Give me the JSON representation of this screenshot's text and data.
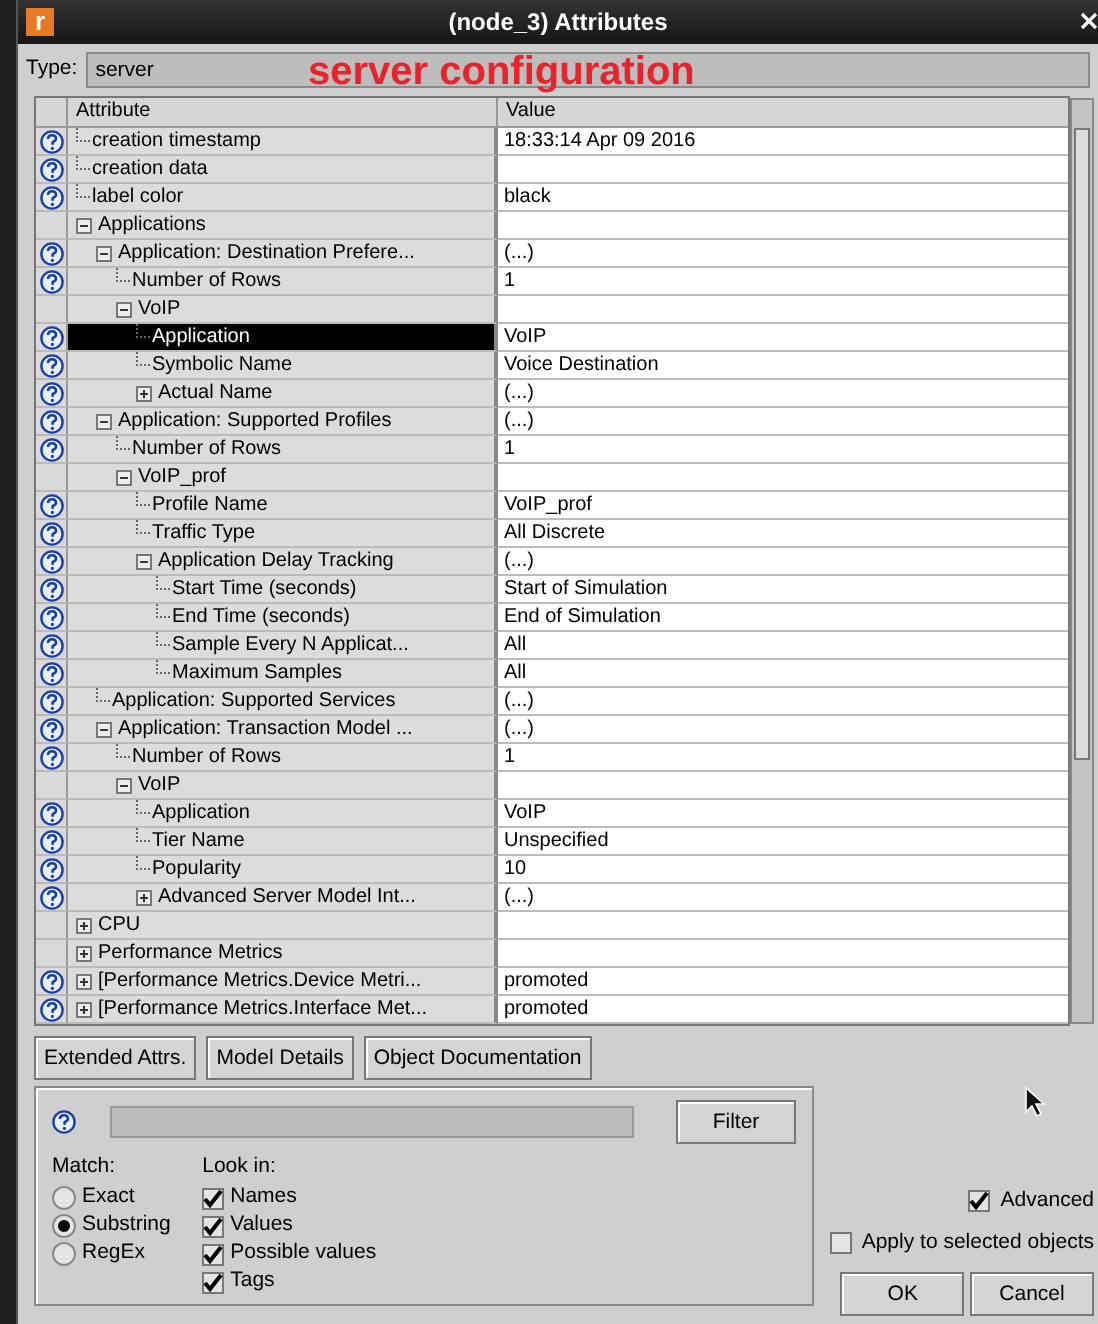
{
  "window": {
    "logo": "r",
    "title": "(node_3) Attributes"
  },
  "type": {
    "label": "Type:",
    "value": "server"
  },
  "annotation": "server configuration",
  "table": {
    "columns": [
      "Attribute",
      "Value"
    ],
    "rows": [
      {
        "name": "creation timestamp",
        "value": "18:33:14 Apr 09 2016",
        "help": true,
        "selected": false
      },
      {
        "name": "creation data",
        "help": true,
        "selected": false
      },
      {
        "name": "label color",
        "value": "black",
        "help": true,
        "selected": false
      },
      {
        "name": "Applications",
        "help": false,
        "expanded": true,
        "selected": false,
        "children": [
          {
            "name": "Application: Destination Prefere...",
            "value": "(...)",
            "help": true,
            "expanded": true,
            "selected": false,
            "children": [
              {
                "name": "Number of Rows",
                "value": "1",
                "help": true,
                "selected": false
              },
              {
                "name": "VoIP",
                "help": false,
                "expanded": true,
                "selected": false,
                "children": [
                  {
                    "name": "Application",
                    "value": "VoIP",
                    "help": true,
                    "selected": true
                  },
                  {
                    "name": "Symbolic Name",
                    "value": "Voice Destination",
                    "help": true,
                    "selected": false
                  },
                  {
                    "name": "Actual Name",
                    "value": "(...)",
                    "help": true,
                    "expanded": false,
                    "selected": false
                  }
                ]
              }
            ]
          },
          {
            "name": "Application: Supported Profiles",
            "value": "(...)",
            "help": true,
            "expanded": true,
            "selected": false,
            "children": [
              {
                "name": "Number of Rows",
                "value": "1",
                "help": true,
                "selected": false
              },
              {
                "name": "VoIP_prof",
                "help": false,
                "expanded": true,
                "selected": false,
                "children": [
                  {
                    "name": "Profile Name",
                    "value": "VoIP_prof",
                    "help": true,
                    "selected": false
                  },
                  {
                    "name": "Traffic Type",
                    "value": "All Discrete",
                    "help": true,
                    "selected": false
                  },
                  {
                    "name": "Application Delay Tracking",
                    "value": "(...)",
                    "help": true,
                    "expanded": true,
                    "selected": false,
                    "children": [
                      {
                        "name": "Start Time (seconds)",
                        "value": "Start of Simulation",
                        "help": true,
                        "selected": false
                      },
                      {
                        "name": "End Time (seconds)",
                        "value": "End of Simulation",
                        "help": true,
                        "selected": false
                      },
                      {
                        "name": "Sample Every N Applicat...",
                        "value": "All",
                        "help": true,
                        "selected": false
                      },
                      {
                        "name": "Maximum Samples",
                        "value": "All",
                        "help": true,
                        "selected": false
                      }
                    ]
                  }
                ]
              }
            ]
          },
          {
            "name": "Application: Supported Services",
            "value": "(...)",
            "help": true,
            "selected": false
          },
          {
            "name": "Application: Transaction Model ...",
            "value": "(...)",
            "help": true,
            "expanded": true,
            "selected": false,
            "children": [
              {
                "name": "Number of Rows",
                "value": "1",
                "help": true,
                "selected": false
              },
              {
                "name": "VoIP",
                "help": false,
                "expanded": true,
                "selected": false,
                "children": [
                  {
                    "name": "Application",
                    "value": "VoIP",
                    "help": true,
                    "selected": false
                  },
                  {
                    "name": "Tier Name",
                    "value": "Unspecified",
                    "help": true,
                    "selected": false
                  },
                  {
                    "name": "Popularity",
                    "value": "10",
                    "help": true,
                    "selected": false
                  },
                  {
                    "name": "Advanced Server Model Int...",
                    "value": "(...)",
                    "help": true,
                    "expanded": false,
                    "selected": false
                  }
                ]
              }
            ]
          }
        ]
      },
      {
        "name": "CPU",
        "help": false,
        "expanded": false,
        "selected": false
      },
      {
        "name": "Performance Metrics",
        "help": false,
        "expanded": false,
        "selected": false
      },
      {
        "name": "[Performance Metrics.Device Metri...",
        "value": "promoted",
        "help": true,
        "expanded": false,
        "selected": false
      },
      {
        "name": "[Performance Metrics.Interface Met...",
        "value": "promoted",
        "help": true,
        "expanded": false,
        "selected": false
      }
    ]
  },
  "buttons": [
    "Extended Attrs.",
    "Model Details",
    "Object Documentation"
  ],
  "filter": {
    "button": "Filter",
    "match_label": "Match:",
    "match_options": [
      {
        "label": "Exact",
        "selected": false
      },
      {
        "label": "Substring",
        "selected": true
      },
      {
        "label": "RegEx",
        "selected": false
      }
    ],
    "look_in_label": "Look in:",
    "look_in": [
      {
        "label": "Names",
        "checked": true
      },
      {
        "label": "Values",
        "checked": true
      },
      {
        "label": "Possible values",
        "checked": true
      },
      {
        "label": "Tags",
        "checked": true
      }
    ]
  },
  "advanced": {
    "label": "Advanced",
    "checked": true
  },
  "apply_selected": {
    "label": "Apply to selected objects",
    "checked": false
  },
  "ok": "OK",
  "cancel": "Cancel"
}
